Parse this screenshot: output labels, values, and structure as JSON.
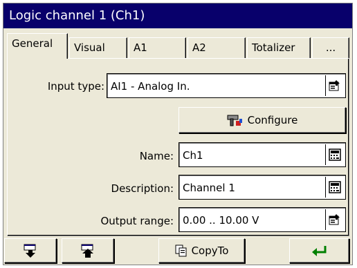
{
  "window": {
    "title": "Logic channel 1 (Ch1)"
  },
  "tabs": [
    {
      "label": "General"
    },
    {
      "label": "Visual"
    },
    {
      "label": "A1"
    },
    {
      "label": "A2"
    },
    {
      "label": "Totalizer"
    },
    {
      "label": "..."
    }
  ],
  "form": {
    "input_type": {
      "label": "Input type:",
      "value": "AI1 - Analog In."
    },
    "configure_label": "Configure",
    "name": {
      "label": "Name:",
      "value": "Ch1"
    },
    "description": {
      "label": "Description:",
      "value": "Channel 1"
    },
    "output_range": {
      "label": "Output range:",
      "value": "0.00 .. 10.00 V"
    }
  },
  "footer": {
    "copyto_label": "CopyTo"
  },
  "colors": {
    "titlebar": "#08006b",
    "face": "#ece9d8",
    "enter_arrow": "#008000"
  }
}
